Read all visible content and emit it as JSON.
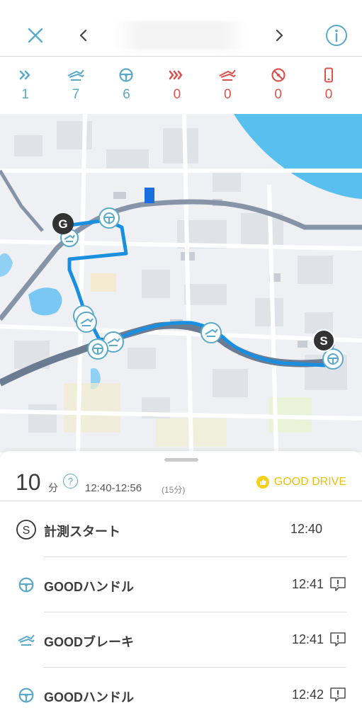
{
  "header": {
    "close_icon": "close-icon",
    "prev_icon": "chevron-left-icon",
    "next_icon": "chevron-right-icon",
    "info_icon": "info-icon"
  },
  "stats": [
    {
      "name": "good-acceleration",
      "count": "1",
      "type": "good"
    },
    {
      "name": "good-brake",
      "count": "7",
      "type": "good"
    },
    {
      "name": "good-handle",
      "count": "6",
      "type": "good"
    },
    {
      "name": "bad-acceleration",
      "count": "0",
      "type": "bad"
    },
    {
      "name": "bad-brake",
      "count": "0",
      "type": "bad"
    },
    {
      "name": "bad-handle",
      "count": "0",
      "type": "bad"
    },
    {
      "name": "phone-usage",
      "count": "0",
      "type": "bad"
    }
  ],
  "map": {
    "start_marker": "S",
    "goal_marker": "G"
  },
  "summary": {
    "score": "10",
    "unit": "分",
    "help": "?",
    "time_range": "12:40-12:56",
    "duration": "(15分)",
    "grade": "GOOD DRIVE"
  },
  "events": [
    {
      "icon": "start-icon",
      "label": "計測スタート",
      "time": "12:40",
      "feedback": false
    },
    {
      "icon": "steering-wheel-icon",
      "label": "GOODハンドル",
      "time": "12:41",
      "feedback": true
    },
    {
      "icon": "brake-icon",
      "label": "GOODブレーキ",
      "time": "12:41",
      "feedback": true
    },
    {
      "icon": "steering-wheel-icon",
      "label": "GOODハンドル",
      "time": "12:42",
      "feedback": true
    }
  ],
  "colors": {
    "accent": "#5aa9c9",
    "bad": "#d9534f",
    "route": "#1a8fe0",
    "gold": "#e9c10e"
  }
}
